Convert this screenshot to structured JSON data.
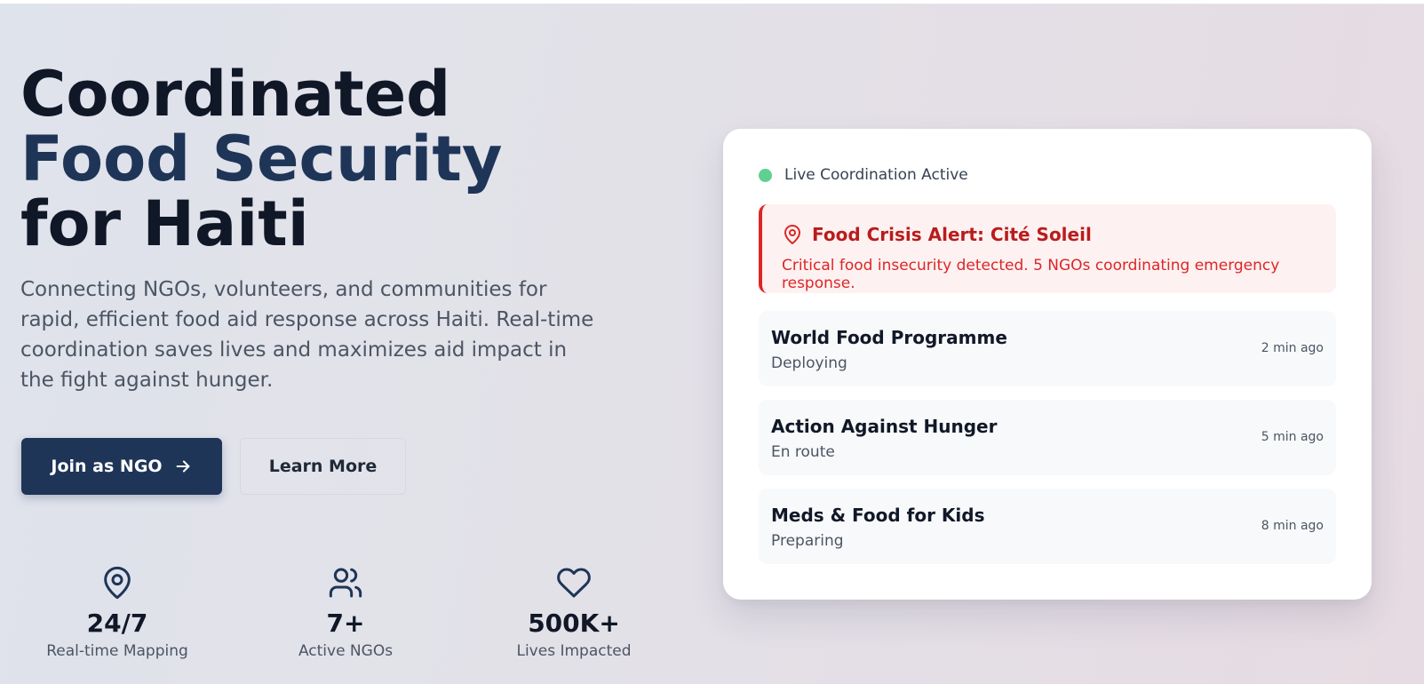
{
  "hero": {
    "headline_line1": "Coordinated",
    "headline_line2": "Food Security",
    "headline_line3": "for Haiti",
    "subtitle": "Connecting NGOs, volunteers, and communities for rapid, efficient food aid response across Haiti. Real-time coordination saves lives and maximizes aid impact in the fight against hunger.",
    "primary_button": "Join as NGO",
    "secondary_button": "Learn More"
  },
  "stats": [
    {
      "icon": "map-pin-icon",
      "value": "24/7",
      "label": "Real-time Mapping"
    },
    {
      "icon": "users-icon",
      "value": "7+",
      "label": "Active NGOs"
    },
    {
      "icon": "heart-icon",
      "value": "500K+",
      "label": "Lives Impacted"
    }
  ],
  "card": {
    "live_status": "Live Coordination Active",
    "alert": {
      "title": "Food Crisis Alert: Cité Soleil",
      "description": "Critical food insecurity detected. 5 NGOs coordinating emergency response."
    },
    "activities": [
      {
        "name": "World Food Programme",
        "status": "Deploying",
        "time": "2 min ago"
      },
      {
        "name": "Action Against Hunger",
        "status": "En route",
        "time": "5 min ago"
      },
      {
        "name": "Meds & Food for Kids",
        "status": "Preparing",
        "time": "8 min ago"
      }
    ]
  },
  "colors": {
    "primary": "#1e3557",
    "alert_red": "#dc2626",
    "live_green": "#5fd08f"
  }
}
